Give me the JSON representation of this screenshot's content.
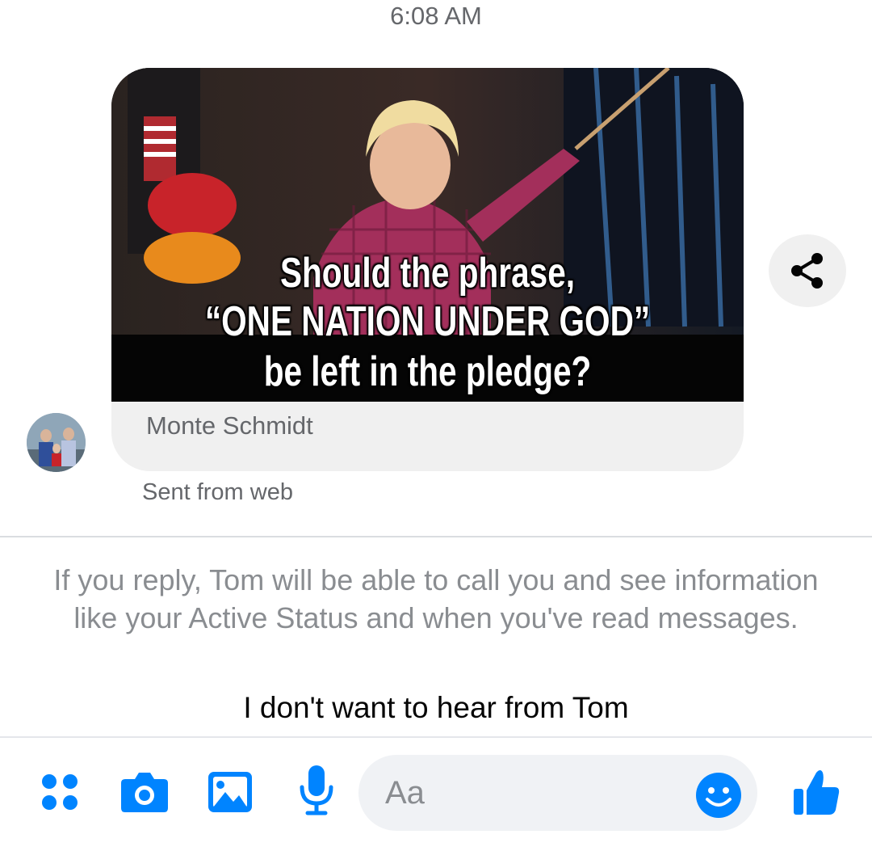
{
  "header": {
    "time": "6:08 AM"
  },
  "message": {
    "image_caption": {
      "line1": "Should the phrase,",
      "line2": "“ONE NATION UNDER GOD”",
      "line3": "be left in the pledge?"
    },
    "sender_name": "Monte Schmidt",
    "sent_from": "Sent from web"
  },
  "notice": {
    "text": "If you reply, Tom will be able to call you and see information like your Active Status and when you've read messages.",
    "ignore_label": "I don't want to hear from Tom"
  },
  "composer": {
    "placeholder": "Aa",
    "icons": [
      "more-icon",
      "camera-icon",
      "gallery-icon",
      "microphone-icon",
      "emoji-icon",
      "thumbs-up-icon"
    ]
  },
  "colors": {
    "accent": "#0084ff",
    "muted_text": "#65676b",
    "bubble_bg": "#f0f0f0"
  }
}
